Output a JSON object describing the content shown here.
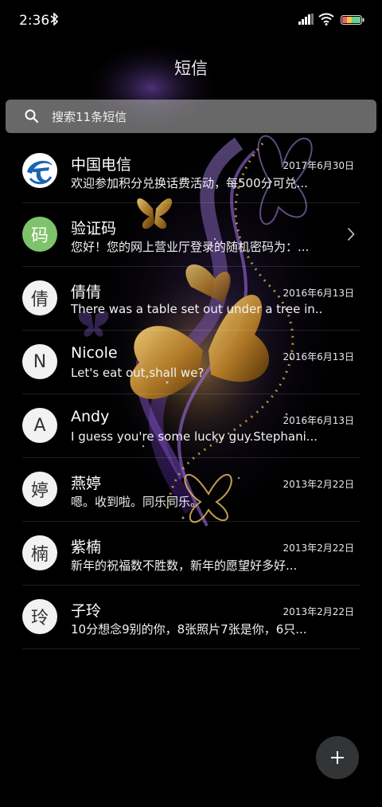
{
  "status_bar": {
    "time": "2:36",
    "icons": [
      "bluetooth-icon",
      "signal-icon",
      "wifi-icon",
      "battery-icon"
    ]
  },
  "header": {
    "title": "短信"
  },
  "search": {
    "placeholder": "搜索11条短信"
  },
  "conversations": [
    {
      "avatar": "",
      "avatar_type": "brand-logo",
      "name": "中国电信",
      "date": "2017年6月30日",
      "preview": "欢迎参加积分兑换话费活动，每500分可兑..."
    },
    {
      "avatar": "码",
      "avatar_type": "green",
      "name": "验证码",
      "date": "",
      "preview": "您好！您的网上营业厅登录的随机密码为：..."
    },
    {
      "avatar": "倩",
      "avatar_type": "default",
      "name": "倩倩",
      "date": "2016年6月13日",
      "preview": "There was a table set out under a tree in..."
    },
    {
      "avatar": "N",
      "avatar_type": "default",
      "name": "Nicole",
      "date": "2016年6月13日",
      "preview": "Let's eat out,shall we?"
    },
    {
      "avatar": "A",
      "avatar_type": "default",
      "name": "Andy",
      "date": "2016年6月13日",
      "preview": "I guess you're some lucky guy.Stephani..."
    },
    {
      "avatar": "婷",
      "avatar_type": "default",
      "name": "燕婷",
      "date": "2013年2月22日",
      "preview": "嗯。收到啦。同乐同乐。"
    },
    {
      "avatar": "楠",
      "avatar_type": "default",
      "name": "紫楠",
      "date": "2013年2月22日",
      "preview": "新年的祝福数不胜数，新年的愿望好多好..."
    },
    {
      "avatar": "玲",
      "avatar_type": "default",
      "name": "子玲",
      "date": "2013年2月22日",
      "preview": "10分想念9别的你，8张照片7张是你，6只..."
    }
  ],
  "fab": {
    "icon": "plus-icon"
  },
  "colors": {
    "background": "#000000",
    "search_bg": "#9a9a9a",
    "avatar_green": "#7ec36b",
    "brand_blue": "#1a64b4",
    "fab_bg": "#333436"
  }
}
